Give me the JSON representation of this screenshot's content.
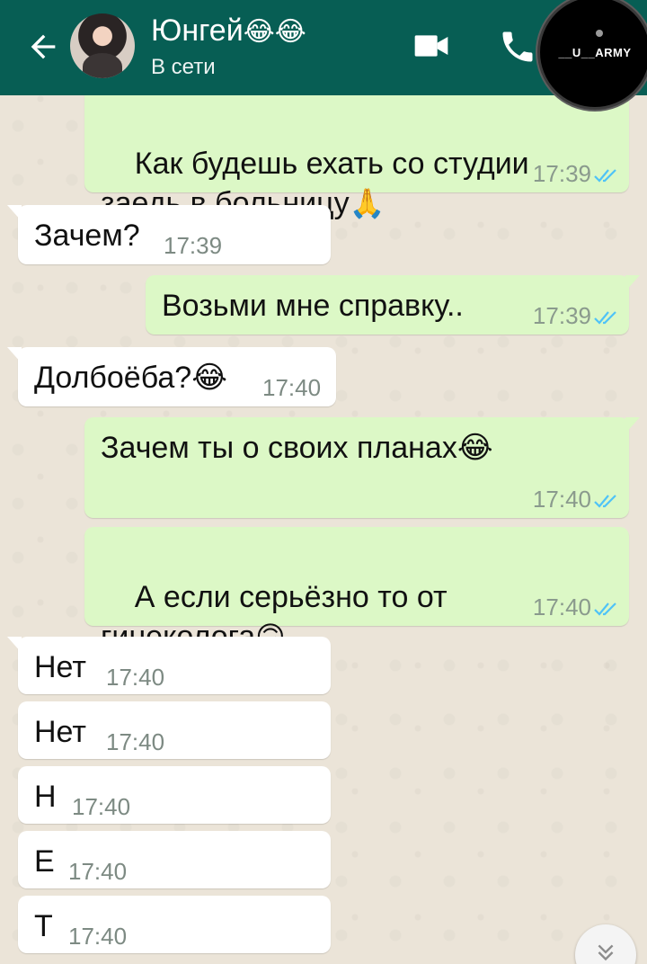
{
  "header": {
    "back_icon": "arrow-left-icon",
    "contact_name": "Юнгей",
    "contact_emoji": "😂😂",
    "status": "В сети",
    "video_icon": "video-camera-icon",
    "call_icon": "phone-icon",
    "watermark_text": "__U__ARMY",
    "background_color": "#075e54"
  },
  "messages": [
    {
      "direction": "out",
      "text": "Как будешь ехать со студии\nзаедь в больницу🙏",
      "time": "17:39",
      "read": true
    },
    {
      "direction": "in",
      "text": "Зачем?",
      "time": "17:39"
    },
    {
      "direction": "out",
      "text": "Возьми мне справку..",
      "time": "17:39",
      "read": true
    },
    {
      "direction": "in",
      "text": "Долбоёба?😂",
      "time": "17:40"
    },
    {
      "direction": "out",
      "text": "Зачем ты о своих планах😂",
      "time": "17:40",
      "read": true
    },
    {
      "direction": "out",
      "text": "А если серьёзно то от\nгинеколога🙃",
      "time": "17:40",
      "read": true
    },
    {
      "direction": "in",
      "text": "Нет",
      "time": "17:40"
    },
    {
      "direction": "in",
      "text": "Нет",
      "time": "17:40"
    },
    {
      "direction": "in",
      "text": "Н",
      "time": "17:40"
    },
    {
      "direction": "in",
      "text": "Е",
      "time": "17:40"
    },
    {
      "direction": "in",
      "text": "Т",
      "time": "17:40"
    }
  ],
  "scroll_down_icon": "double-chevron-down-icon",
  "colors": {
    "outgoing_bubble": "#dcf8c6",
    "incoming_bubble": "#ffffff",
    "read_ticks": "#4fc3f7",
    "chat_background": "#ebe4d8"
  }
}
